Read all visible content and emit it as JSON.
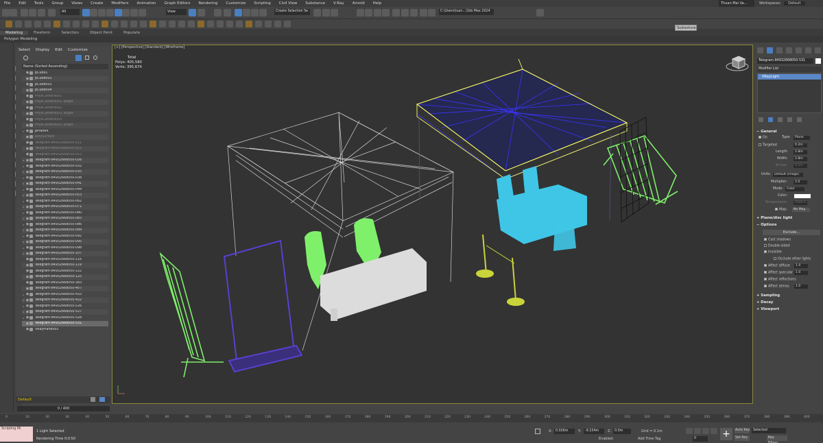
{
  "menubar": {
    "items": [
      "File",
      "Edit",
      "Tools",
      "Group",
      "Views",
      "Create",
      "Modifiers",
      "Animation",
      "Graph Editors",
      "Rendering",
      "Customize",
      "Scripting",
      "Civil View",
      "Substance",
      "V-Ray",
      "Arnold",
      "Help"
    ],
    "user": "Thuan Mai Va...",
    "workspace_label": "Workspaces:",
    "workspace_value": "Default"
  },
  "toolbar": {
    "filter_all": "All",
    "ref_coord": "View",
    "selection_set": "Create Selection Se",
    "project_path": "C:\\Users\\tuan...\\3ds Max 2024"
  },
  "tooltip": "Subtexture",
  "ribbon": {
    "tabs": [
      "Modeling",
      "Freeform",
      "Selection",
      "Object Paint",
      "Populate"
    ],
    "active": "Modeling",
    "sub": "Polygon Modeling"
  },
  "explorer": {
    "menu": [
      "Select",
      "Display",
      "Edit",
      "Customize"
    ],
    "header": "Name (Sorted Ascending)",
    "rows": [
      {
        "name": "pCube1",
        "state": "normal"
      },
      {
        "name": "pCube002",
        "state": "normal"
      },
      {
        "name": "pCube003",
        "state": "normal"
      },
      {
        "name": "pCube004",
        "state": "normal"
      },
      {
        "name": "PhysCamera001",
        "state": "dim"
      },
      {
        "name": "PhysCamera001.Target",
        "state": "dim"
      },
      {
        "name": "PhysCamera002",
        "state": "dim"
      },
      {
        "name": "PhysCamera002.Target",
        "state": "dim"
      },
      {
        "name": "PhysCamera003",
        "state": "dim"
      },
      {
        "name": "PhysCamera003.Target",
        "state": "dim"
      },
      {
        "name": "pPlane4",
        "state": "normal"
      },
      {
        "name": "polySurface",
        "state": "dim"
      },
      {
        "name": "Telegram-84932668050-011",
        "state": "dim"
      },
      {
        "name": "Telegram-84932668050-012",
        "state": "dim"
      },
      {
        "name": "Telegram-84932668050-013",
        "state": "dim"
      },
      {
        "name": "Telegram-84932668050-026",
        "state": "normal"
      },
      {
        "name": "Telegram-84932668050-032",
        "state": "normal"
      },
      {
        "name": "Telegram-84932668050-035",
        "state": "normal"
      },
      {
        "name": "Telegram-84932668050-038",
        "state": "normal"
      },
      {
        "name": "Telegram-84932668050-041",
        "state": "normal"
      },
      {
        "name": "Telegram-84932668050-044",
        "state": "normal"
      },
      {
        "name": "Telegram-84932668050-053",
        "state": "normal"
      },
      {
        "name": "Telegram-84932668050-062",
        "state": "normal"
      },
      {
        "name": "Telegram-84932668050-071",
        "state": "normal"
      },
      {
        "name": "Telegram-84932668050-080",
        "state": "normal"
      },
      {
        "name": "Telegram-84932668050-083",
        "state": "normal"
      },
      {
        "name": "Telegram-84932668050-086",
        "state": "normal"
      },
      {
        "name": "Telegram-84932668050-089",
        "state": "normal"
      },
      {
        "name": "Telegram-84932668050-092",
        "state": "normal"
      },
      {
        "name": "Telegram-84932668050-095",
        "state": "normal"
      },
      {
        "name": "Telegram-84932668050-098",
        "state": "normal"
      },
      {
        "name": "Telegram-84932668050-107",
        "state": "normal"
      },
      {
        "name": "Telegram-84932668050-116",
        "state": "normal"
      },
      {
        "name": "Telegram-84932668050-119",
        "state": "normal"
      },
      {
        "name": "Telegram-84932668050-122",
        "state": "normal"
      },
      {
        "name": "Telegram-84932668050-125",
        "state": "normal"
      },
      {
        "name": "Telegram-84932668050-383",
        "state": "normal"
      },
      {
        "name": "Telegram-84932668050-407",
        "state": "normal"
      },
      {
        "name": "Telegram-84932668050-410",
        "state": "normal"
      },
      {
        "name": "Telegram-84932668050-422",
        "state": "normal"
      },
      {
        "name": "Telegram-84932668050-526",
        "state": "normal"
      },
      {
        "name": "Telegram-84932668050-527",
        "state": "normal"
      },
      {
        "name": "Telegram-84932668050-528",
        "state": "normal"
      },
      {
        "name": "Telegram-84932668050-531",
        "state": "selected"
      },
      {
        "name": "VRayPlane001",
        "state": "normal"
      }
    ],
    "layer": "Default"
  },
  "viewport": {
    "label": "[+] [Perspective] [Standard] [Wireframe]",
    "stats_title": "Total",
    "polys_label": "Polys:",
    "polys_value": "405,580",
    "verts_label": "Verts:",
    "verts_value": "395,674"
  },
  "command_panel": {
    "object_name": "Telegram-84932668050-531",
    "modifier_list": "Modifier List",
    "stack_item": "VRayLight",
    "general": {
      "title": "General",
      "on": "On",
      "type_label": "Type:",
      "type_value": "Plane",
      "targeted": "Targeted",
      "targeted_value": "0.2m",
      "length_label": "Length:",
      "length_value": "2.8m",
      "width_label": "Width:",
      "width_value": "2.8m",
      "wsize_label": "W size:",
      "wsize_value": "0.1m",
      "units_label": "Units:",
      "units_value": "Default (image)",
      "multiplier_label": "Multiplier:",
      "multiplier_value": "2.0",
      "mode_label": "Mode:",
      "mode_value": "Color",
      "color_label": "Color:",
      "temperature_label": "Temperature:",
      "temperature_value": "6500.0",
      "texmap_label": "Map:",
      "texmap_value": "No Map"
    },
    "plane_disc": "Plane/disc light",
    "options": {
      "title": "Options",
      "include": "Exclude...",
      "cast_shadows": "Cast shadows",
      "double_sided": "Double-sided",
      "invisible": "Invisible",
      "occlude": "Occlude other lights",
      "affect_diffuse": "Affect diffuse",
      "affect_diffuse_v": "1.0",
      "affect_specular": "Affect specular",
      "affect_specular_v": "1.0",
      "affect_reflections": "Affect reflections",
      "affect_atmos": "Affect atmos.",
      "affect_atmos_v": "1.0"
    },
    "sampling": "Sampling",
    "decay": "Decay",
    "viewport_sec": "Viewport"
  },
  "timeline": {
    "slider": "0 / 400",
    "ticks": [
      "0",
      "10",
      "20",
      "30",
      "40",
      "50",
      "60",
      "70",
      "80",
      "90",
      "100",
      "110",
      "120",
      "130",
      "140",
      "150",
      "160",
      "170",
      "180",
      "190",
      "200",
      "210",
      "220",
      "230",
      "240",
      "250",
      "260",
      "270",
      "280",
      "290",
      "300",
      "310",
      "320",
      "330",
      "340",
      "350",
      "360",
      "370",
      "380",
      "390",
      "400"
    ]
  },
  "status": {
    "maxscript": "Scripting Mi",
    "selected": "1 Light Selected",
    "render_time": "Rendering Time  0:0:50",
    "x_label": "X:",
    "x_value": "0.026m",
    "y_label": "Y:",
    "y_value": "-9.154m",
    "z_label": "Z:",
    "z_value": "0.0m",
    "grid": "Grid = 0.1m",
    "enabled": "Enabled:",
    "add_time_tag": "Add Time Tag",
    "auto_key": "Auto Key",
    "set_key": "Set Key",
    "selected_dd": "Selected",
    "key_filters": "Key Filters...",
    "frame": "0"
  },
  "colors": {
    "viewport_bg": "#333333",
    "selection_yellow": "#ffff66",
    "wire_white": "#e6e6e6",
    "green_obj": "#7ff06a",
    "blue_obj": "#3fc6e6",
    "purple_obj": "#5a3fd0"
  }
}
